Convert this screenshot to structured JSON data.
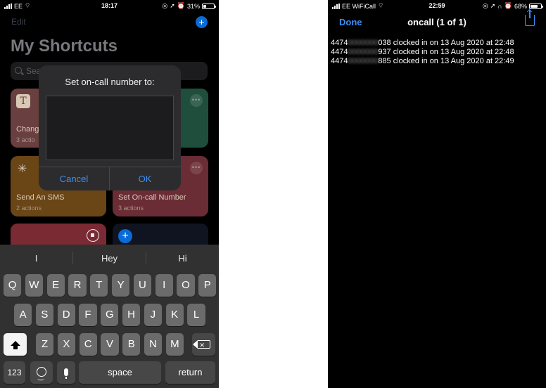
{
  "left_phone": {
    "status": {
      "carrier": "EE",
      "time": "18:17",
      "battery": "31%",
      "battery_level": 0.31
    },
    "header": {
      "edit_label": "Edit",
      "add_label": "+"
    },
    "title": "My Shortcuts",
    "search": {
      "placeholder": "Sea"
    },
    "tiles": [
      {
        "name": "Chang",
        "sub": "3 actio",
        "icon": "T"
      },
      {
        "name": "",
        "sub": ""
      },
      {
        "name": "Send An SMS",
        "sub": "2 actions"
      },
      {
        "name": "Set On-call Number",
        "sub": "3 actions"
      }
    ],
    "tile_more": "•••",
    "dialog": {
      "title": "Set on-call number to:",
      "value": "",
      "cancel_label": "Cancel",
      "ok_label": "OK"
    },
    "keyboard": {
      "predictions": [
        "I",
        "Hey",
        "Hi"
      ],
      "row1": [
        "Q",
        "W",
        "E",
        "R",
        "T",
        "Y",
        "U",
        "I",
        "O",
        "P"
      ],
      "row2": [
        "A",
        "S",
        "D",
        "F",
        "G",
        "H",
        "J",
        "K",
        "L"
      ],
      "row3": [
        "Z",
        "X",
        "C",
        "V",
        "B",
        "N",
        "M"
      ],
      "numbers_label": "123",
      "space_label": "space",
      "return_label": "return"
    }
  },
  "right_phone": {
    "status": {
      "carrier": "EE WiFiCall",
      "time": "22:59",
      "battery": "68%",
      "battery_level": 0.68
    },
    "nav": {
      "done_label": "Done",
      "title": "oncall (1 of 1)"
    },
    "log_lines": [
      {
        "prefix": "4474",
        "hidden": "0000000",
        "suffix": "038 clocked in on 13 Aug 2020 at 22:48"
      },
      {
        "prefix": "4474",
        "hidden": "0000000",
        "suffix": "937 clocked in on 13 Aug 2020 at 22:48"
      },
      {
        "prefix": "4474",
        "hidden": "0000000",
        "suffix": "885 clocked in on 13 Aug 2020 at 22:49"
      }
    ]
  }
}
